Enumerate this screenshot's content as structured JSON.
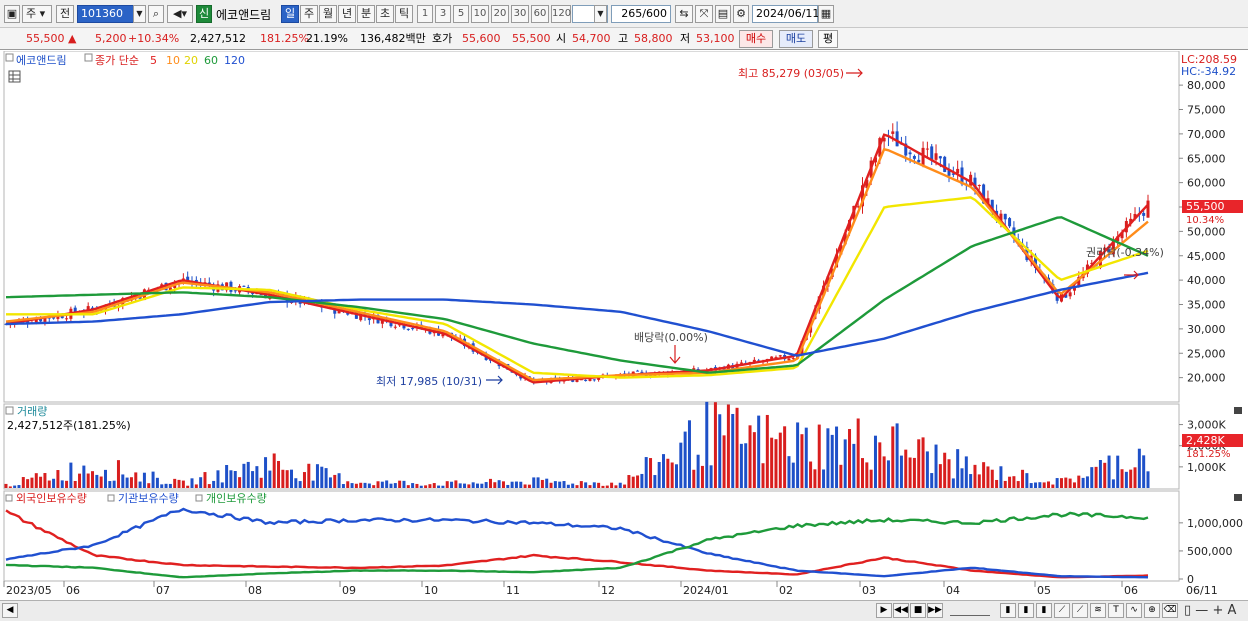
{
  "toolbar": {
    "market_label": "주",
    "prev_label": "전",
    "stock_code": "101360",
    "stock_name": "에코앤드림",
    "new_badge": "신",
    "periods": [
      "일",
      "주",
      "월",
      "년",
      "분",
      "초",
      "틱"
    ],
    "selected_period": "일",
    "intervals": [
      "1",
      "3",
      "5",
      "10",
      "20",
      "30",
      "60",
      "120"
    ],
    "bar_count": "265",
    "bar_max": "/600",
    "date": "2024/06/11"
  },
  "quote": {
    "price": "55,500",
    "change": "5,200",
    "change_pct": "+10.34%",
    "volume": "2,427,512",
    "volume_ratio": "181.25%",
    "turnover": "21.19%",
    "amount": "136,482백만",
    "ask_label": "호가",
    "ask": "55,600",
    "bid": "55,500",
    "open_label": "시",
    "open": "54,700",
    "high_label": "고",
    "high": "58,800",
    "low_label": "저",
    "low": "53,100",
    "buy_label": "매수",
    "sell_label": "매도",
    "eval_label": "평"
  },
  "price_panel": {
    "legend_name": "에코앤드림",
    "legend_ma": "종가 단순",
    "ma_periods": [
      "5",
      "10",
      "20",
      "60",
      "120"
    ],
    "lc_label": "LC:208.59",
    "hc_label": "HC:-34.92",
    "last_price_tag": "55,500",
    "last_pct_tag": "10.34%",
    "high_annotation": "최고 85,279 (03/05)",
    "low_annotation": "최저 17,985 (10/31)",
    "dividend_annotation": "배당락(0.00%)",
    "rights_annotation": "권리락(-0.34%)",
    "y_labels": [
      "80,000",
      "75,000",
      "70,000",
      "65,000",
      "60,000",
      "55,000",
      "50,000",
      "45,000",
      "40,000",
      "35,000",
      "30,000",
      "25,000",
      "20,000"
    ]
  },
  "volume_panel": {
    "title": "거래량",
    "info": "2,427,512주(181.25%)",
    "y_labels": [
      "3,000K",
      "2,000K",
      "1,000K"
    ],
    "last_tag": "2,428K",
    "last_pct": "181.25%"
  },
  "holding_panel": {
    "legends": [
      "외국인보유수량",
      "기관보유수량",
      "개인보유수량"
    ],
    "y_labels": [
      "1,000,000",
      "500,000",
      "0"
    ]
  },
  "x_axis": {
    "labels": [
      "2023/05",
      "06",
      "07",
      "08",
      "09",
      "10",
      "11",
      "12",
      "2024/01",
      "02",
      "03",
      "04",
      "05",
      "06",
      "06/11"
    ]
  },
  "colors": {
    "up": "#d81e1e",
    "down": "#1e50c8",
    "ma5": "#e02020",
    "ma10": "#ff8c1a",
    "ma20": "#f2e600",
    "ma60": "#1e9a3a",
    "ma120": "#2050d0",
    "tag_bg": "#e8252a"
  },
  "chart_data": [
    {
      "type": "line",
      "title": "",
      "xlabel": "",
      "ylabel": "",
      "ylim": [
        15000,
        87000
      ],
      "x": [
        "2023/05",
        "06",
        "07",
        "08",
        "09",
        "10",
        "11",
        "12",
        "2024/01",
        "02",
        "03",
        "04",
        "05",
        "06"
      ],
      "series": [
        {
          "name": "5",
          "values": [
            31000,
            34000,
            40000,
            37000,
            33000,
            29000,
            19000,
            20500,
            21500,
            24500,
            70000,
            60000,
            36000,
            55500
          ]
        },
        {
          "name": "10",
          "values": [
            31500,
            33500,
            39500,
            37500,
            33500,
            29500,
            19500,
            20500,
            21000,
            23500,
            67000,
            59000,
            37000,
            52000
          ]
        },
        {
          "name": "20",
          "values": [
            33000,
            33000,
            38500,
            38000,
            34000,
            31000,
            21000,
            20000,
            20500,
            22000,
            55000,
            57000,
            40000,
            46000
          ]
        },
        {
          "name": "60",
          "values": [
            36500,
            37000,
            37500,
            36500,
            34500,
            32000,
            27000,
            23500,
            21000,
            22500,
            36000,
            47000,
            53000,
            45000
          ]
        },
        {
          "name": "120",
          "values": [
            31000,
            31500,
            33000,
            35500,
            36000,
            36000,
            35000,
            33500,
            29500,
            24500,
            28000,
            33500,
            38000,
            41500
          ]
        }
      ]
    },
    {
      "type": "bar",
      "title": "거래량",
      "ylim": [
        0,
        3500000
      ],
      "categories": [
        "2023/05",
        "06",
        "07",
        "08",
        "09",
        "10",
        "11",
        "12",
        "2024/01",
        "02",
        "03",
        "04",
        "05",
        "06"
      ],
      "values": [
        200000,
        1500000,
        300000,
        1700000,
        400000,
        300000,
        450000,
        300000,
        3700000,
        3000000,
        3100000,
        1300000,
        400000,
        2427512
      ]
    },
    {
      "type": "line",
      "title": "",
      "ylim": [
        0,
        1300000
      ],
      "x": [
        "2023/05",
        "06",
        "07",
        "08",
        "09",
        "10",
        "11",
        "12",
        "2024/01",
        "02",
        "03",
        "04",
        "05",
        "06"
      ],
      "series": [
        {
          "name": "외국인보유수량",
          "values": [
            1200000,
            420000,
            250000,
            220000,
            200000,
            240000,
            420000,
            300000,
            150000,
            80000,
            380000,
            150000,
            30000,
            60000
          ]
        },
        {
          "name": "기관보유수량",
          "values": [
            350000,
            600000,
            1250000,
            1000000,
            1050000,
            1050000,
            1000000,
            900000,
            450000,
            150000,
            50000,
            200000,
            50000,
            30000
          ]
        },
        {
          "name": "개인보유수량",
          "values": [
            250000,
            200000,
            30000,
            100000,
            150000,
            150000,
            120000,
            200000,
            700000,
            950000,
            1050000,
            1000000,
            1150000,
            1100000
          ]
        }
      ]
    }
  ]
}
